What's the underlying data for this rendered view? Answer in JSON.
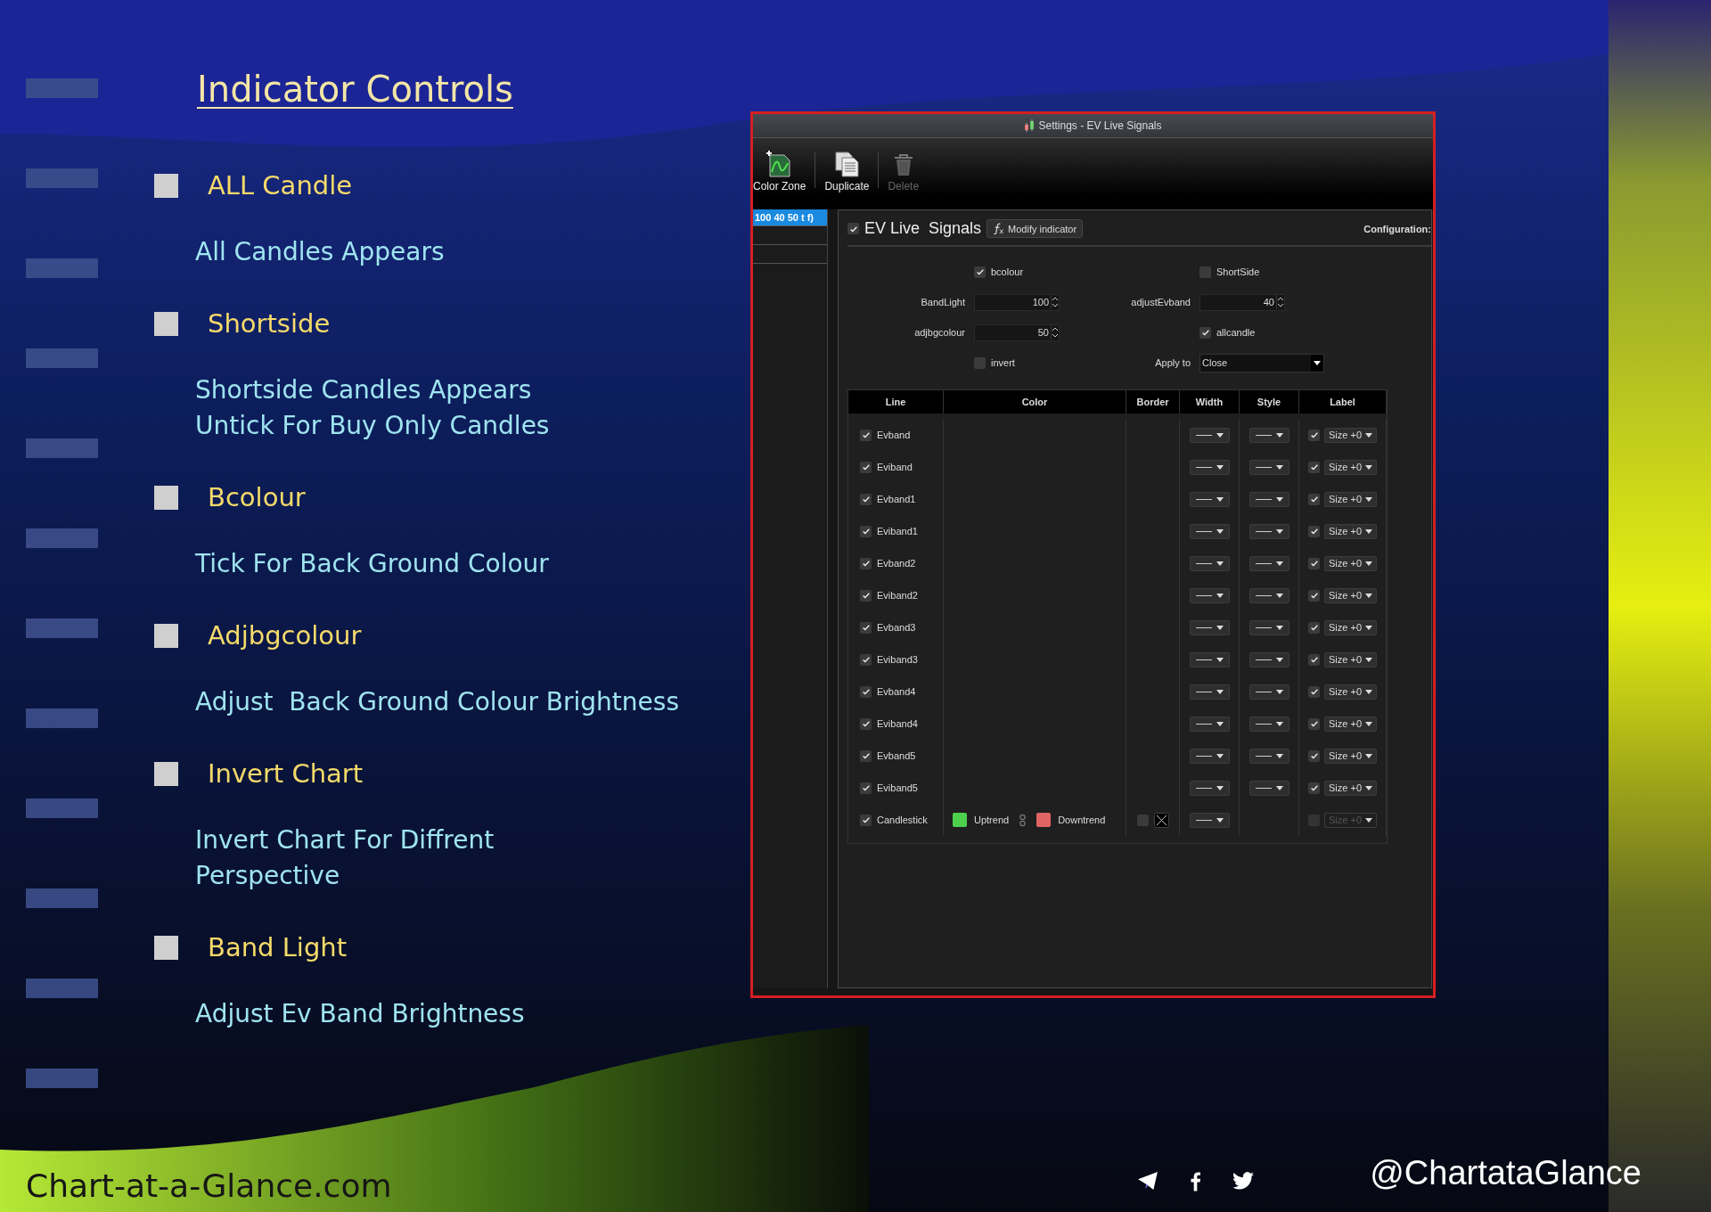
{
  "slide": {
    "title": "Indicator Controls",
    "items": [
      {
        "heading": "ALL Candle",
        "description": "All Candles Appears"
      },
      {
        "heading": "Shortside",
        "description": "Shortside Candles Appears\nUntick For Buy Only Candles"
      },
      {
        "heading": "Bcolour",
        "description": "Tick For Back Ground Colour"
      },
      {
        "heading": "Adjbgcolour",
        "description": "Adjust  Back Ground Colour Brightness"
      },
      {
        "heading": "Invert Chart",
        "description": "Invert Chart For Diffrent\nPerspective"
      },
      {
        "heading": "Band Light",
        "description": "Adjust Ev Band Brightness"
      }
    ],
    "website": "Chart-at-a-Glance.com",
    "handle": "@ChartataGlance"
  },
  "settings_window": {
    "title": "Settings - EV Live  Signals",
    "toolbar": [
      {
        "kind": "chart",
        "label": "Color Zone",
        "disabled": false
      },
      {
        "kind": "copy",
        "label": "Duplicate",
        "disabled": false
      },
      {
        "kind": "trash",
        "label": "Delete",
        "disabled": true
      }
    ],
    "indicator_list": [
      {
        "label": "100 40 50 t f)",
        "selected": true
      }
    ],
    "indicator": {
      "name": "EV Live  Signals",
      "enabled": true,
      "modify_button": "Modify indicator",
      "configuration_label": "Configuration:"
    },
    "params": [
      {
        "kind": "checkbox",
        "label": "bcolour",
        "checked": true
      },
      {
        "kind": "checkbox",
        "label": "ShortSide",
        "checked": false
      },
      {
        "kind": "spinner",
        "label": "BandLight",
        "value": "100"
      },
      {
        "kind": "spinner",
        "label": "adjustEvband",
        "value": "40"
      },
      {
        "kind": "spinner",
        "label": "adjbgcolour",
        "value": "50"
      },
      {
        "kind": "checkbox",
        "label": "allcandle",
        "checked": true
      },
      {
        "kind": "checkbox",
        "label": "invert",
        "checked": false
      },
      {
        "kind": "dropdown",
        "label": "Apply to",
        "value": "Close"
      }
    ],
    "table": {
      "columns": [
        "Line",
        "Color",
        "Border",
        "Width",
        "Style",
        "Label"
      ],
      "rows": [
        {
          "kind": "band",
          "line": "Evband",
          "checked": true,
          "label_checked": true,
          "label_size": "Size +0",
          "label_disabled": false
        },
        {
          "kind": "band",
          "line": "Eviband",
          "checked": true,
          "label_checked": true,
          "label_size": "Size +0",
          "label_disabled": false
        },
        {
          "kind": "band",
          "line": "Evband1",
          "checked": true,
          "label_checked": true,
          "label_size": "Size +0",
          "label_disabled": false
        },
        {
          "kind": "band",
          "line": "Eviband1",
          "checked": true,
          "label_checked": true,
          "label_size": "Size +0",
          "label_disabled": false
        },
        {
          "kind": "band",
          "line": "Evband2",
          "checked": true,
          "label_checked": true,
          "label_size": "Size +0",
          "label_disabled": false
        },
        {
          "kind": "band",
          "line": "Eviband2",
          "checked": true,
          "label_checked": true,
          "label_size": "Size +0",
          "label_disabled": false
        },
        {
          "kind": "band",
          "line": "Evband3",
          "checked": true,
          "label_checked": true,
          "label_size": "Size +0",
          "label_disabled": false
        },
        {
          "kind": "band",
          "line": "Eviband3",
          "checked": true,
          "label_checked": true,
          "label_size": "Size +0",
          "label_disabled": false
        },
        {
          "kind": "band",
          "line": "Evband4",
          "checked": true,
          "label_checked": true,
          "label_size": "Size +0",
          "label_disabled": false
        },
        {
          "kind": "band",
          "line": "Eviband4",
          "checked": true,
          "label_checked": true,
          "label_size": "Size +0",
          "label_disabled": false
        },
        {
          "kind": "band",
          "line": "Evband5",
          "checked": true,
          "label_checked": true,
          "label_size": "Size +0",
          "label_disabled": false
        },
        {
          "kind": "band",
          "line": "Eviband5",
          "checked": true,
          "label_checked": true,
          "label_size": "Size +0",
          "label_disabled": false
        },
        {
          "kind": "candlestick",
          "line": "Candlestick",
          "checked": true,
          "colors": [
            {
              "label": "Uptrend",
              "color": "#4cd04c"
            },
            {
              "label": "Downtrend",
              "color": "#e06464"
            }
          ],
          "border_checked": false,
          "label_checked": false,
          "label_size": "Size +0",
          "label_disabled": true
        }
      ]
    }
  }
}
